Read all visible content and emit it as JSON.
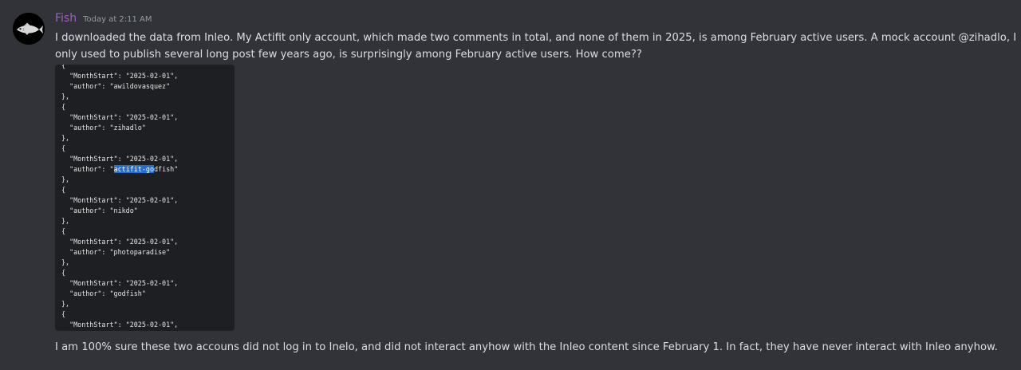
{
  "message": {
    "username": "Fish",
    "timestamp": "Today at 2:11 AM",
    "text_line1": "I downloaded the data from Inleo. My Actifit only account, which made two comments in total, and none of them in 2025, is among February active users. A mock account @zihadlo, I",
    "text_line2": "only used to publish several long post few years ago, is surprisingly among February active users. How come??",
    "text_line3": "I am 100% sure these two accouns did not log in to Inelo, and did not interact anyhow with the Inleo content since February 1. In fact, they have never interact with Inleo anyhow.",
    "avatar_icon": "fish-icon"
  },
  "code_image": {
    "lines": [
      "{",
      "  \"MonthStart\": \"2025-02-01\",",
      "  \"author\": \"awildovasquez\"",
      "},",
      "{",
      "  \"MonthStart\": \"2025-02-01\",",
      "  \"author\": \"zihadlo\"",
      "},",
      "{",
      "  \"MonthStart\": \"2025-02-01\",",
      "  \"author\": \"",
      "},",
      "{",
      "  \"MonthStart\": \"2025-02-01\",",
      "  \"author\": \"nikdo\"",
      "},",
      "{",
      "  \"MonthStart\": \"2025-02-01\",",
      "  \"author\": \"photoparadise\"",
      "},",
      "{",
      "  \"MonthStart\": \"2025-02-01\",",
      "  \"author\": \"godfish\"",
      "},",
      "{",
      "  \"MonthStart\": \"2025-02-01\","
    ],
    "highlight_line": {
      "prefix": "  \"author\": \"",
      "highlighted": "actifit-go",
      "suffix": "dfish\""
    },
    "highlight_color": "#1e6fd8"
  },
  "colors": {
    "background": "#313338",
    "username": "#a35cc9",
    "text": "#dbdee1",
    "timestamp": "#949ba4",
    "code_background": "#1e1f22"
  }
}
